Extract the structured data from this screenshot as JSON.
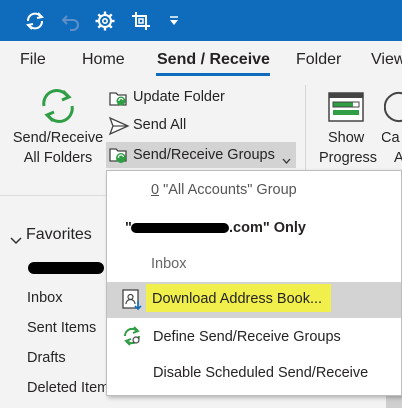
{
  "colors": {
    "titlebar": "#0f6cbd",
    "accent": "#0f6cbd",
    "ribbon_bg": "#f3f3f3",
    "highlight": "#f3f23c"
  },
  "titlebar": {
    "icons": [
      "sync-icon",
      "undo-icon",
      "settings-gear-icon",
      "screen-capture-icon",
      "customize-quick-access-dropdown-icon"
    ]
  },
  "tabs": [
    {
      "label": "File"
    },
    {
      "label": "Home"
    },
    {
      "label": "Send / Receive",
      "active": true
    },
    {
      "label": "Folder"
    },
    {
      "label": "View"
    }
  ],
  "ribbon": {
    "send_receive_all_line1": "Send/Receive",
    "send_receive_all_line2": "All Folders",
    "update_folder": "Update Folder",
    "send_all": "Send All",
    "send_receive_groups": "Send/Receive Groups",
    "show_progress_line1": "Show",
    "show_progress_line2": "Progress",
    "cancel_all_line1": "Ca",
    "cancel_all_line2": "A"
  },
  "dropdown": {
    "item_all_accounts_prefix": "0",
    "item_all_accounts": " \"All Accounts\" Group",
    "item_account_quote": "\"",
    "item_account_suffix": ".com\" Only",
    "item_inbox": "Inbox",
    "item_download_address_book": "Download Address Book...",
    "item_define_groups": "Define Send/Receive Groups",
    "item_disable_scheduled": "Disable Scheduled Send/Receive"
  },
  "folders": {
    "favorites": "Favorites",
    "inbox": "Inbox",
    "sent_items": "Sent Items",
    "drafts": "Drafts",
    "deleted_items": "Deleted Items"
  }
}
